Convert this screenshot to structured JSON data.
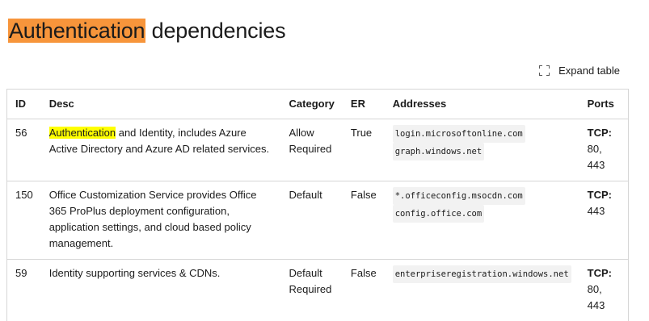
{
  "heading": {
    "highlighted": "Authentication",
    "rest": " dependencies"
  },
  "expand_table": {
    "label": "Expand table",
    "icon": "expand-icon"
  },
  "table": {
    "headers": {
      "id": "ID",
      "desc": "Desc",
      "category": "Category",
      "er": "ER",
      "addresses": "Addresses",
      "ports": "Ports"
    },
    "rows": [
      {
        "id": "56",
        "desc_highlight": "Authentication",
        "desc_rest": " and Identity, includes Azure Active Directory and Azure AD related services.",
        "category": "Allow Required",
        "er": "True",
        "addresses": [
          "login.microsoftonline.com",
          "graph.windows.net"
        ],
        "port_proto": "TCP:",
        "port_values": "80, 443"
      },
      {
        "id": "150",
        "desc_highlight": "",
        "desc_rest": "Office Customization Service provides Office 365 ProPlus deployment configuration, application settings, and cloud based policy management.",
        "category": "Default",
        "er": "False",
        "addresses": [
          "*.officeconfig.msocdn.com",
          "config.office.com"
        ],
        "port_proto": "TCP:",
        "port_values": "443"
      },
      {
        "id": "59",
        "desc_highlight": "",
        "desc_rest": "Identity supporting services & CDNs.",
        "category": "Default Required",
        "er": "False",
        "addresses": [
          "enterpriseregistration.windows.net"
        ],
        "port_proto": "TCP:",
        "port_values": "80, 443"
      }
    ]
  },
  "colors": {
    "heading_highlight": "#f7953b",
    "text_highlight": "#ffff00",
    "border": "#d6d6d6",
    "code_bg": "#f2f2f2"
  }
}
